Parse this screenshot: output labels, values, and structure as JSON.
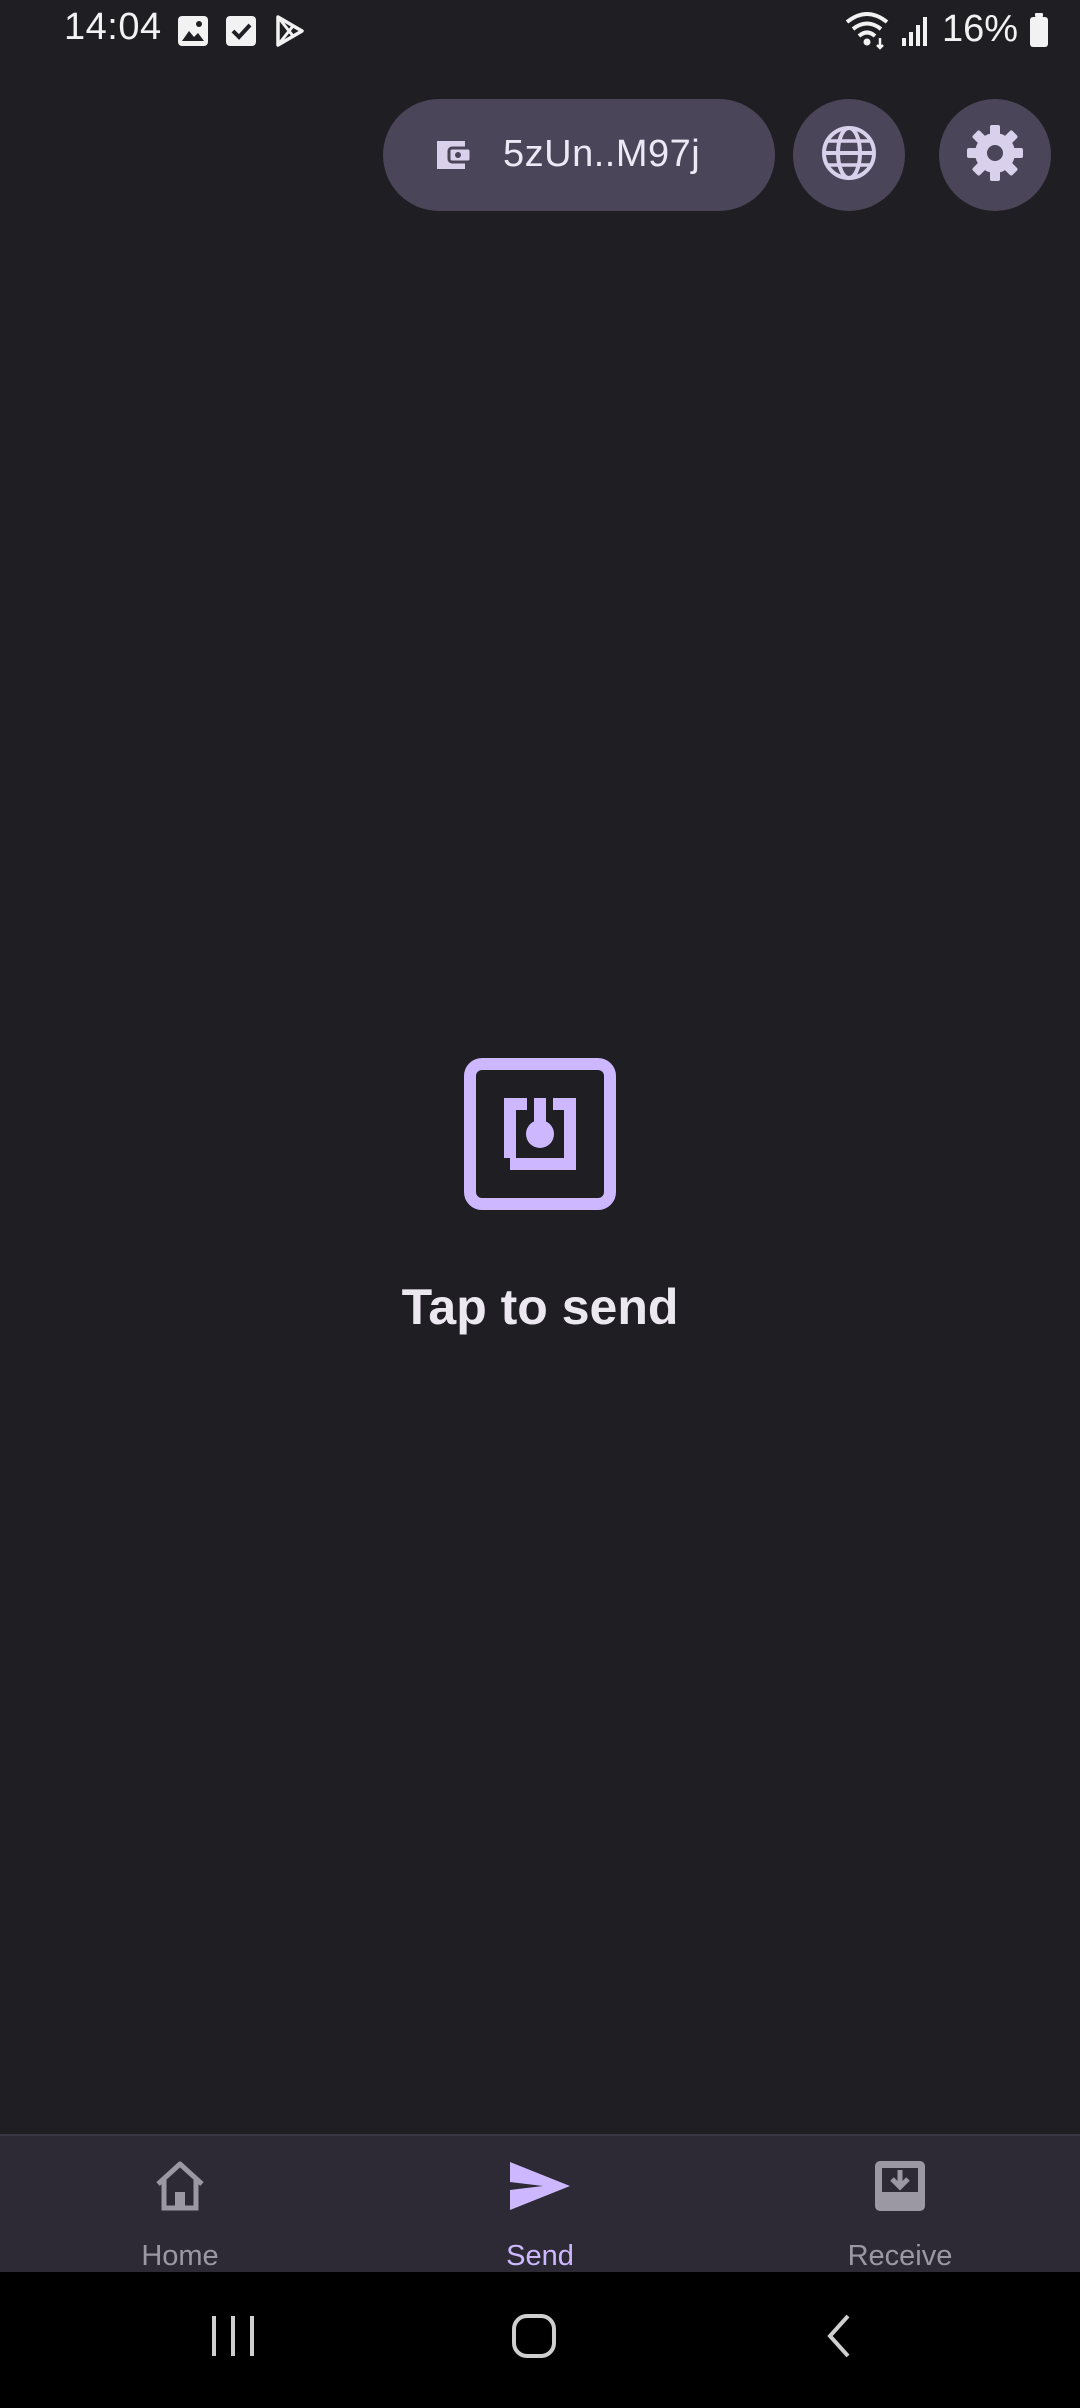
{
  "status_bar": {
    "time": "14:04",
    "left_icons": [
      "image-icon",
      "checkbox-icon",
      "play-store-icon"
    ],
    "right_icons": [
      "wifi-icon",
      "signal-icon"
    ],
    "battery_percent": "16%"
  },
  "header": {
    "wallet_address": "5zUn..M97j",
    "wallet_icon": "wallet-icon",
    "network_button_icon": "globe-icon",
    "settings_button_icon": "gear-icon"
  },
  "main": {
    "icon": "nfc-icon",
    "prompt": "Tap to send"
  },
  "bottom_nav": {
    "items": [
      {
        "label": "Home",
        "icon": "home-icon",
        "active": false
      },
      {
        "label": "Send",
        "icon": "send-icon",
        "active": true
      },
      {
        "label": "Receive",
        "icon": "inbox-download-icon",
        "active": false
      }
    ]
  },
  "system_nav": [
    "recents-icon",
    "home-circle-icon",
    "back-icon"
  ],
  "colors": {
    "background": "#1f1e23",
    "accent": "#cdb8ff",
    "chip": "#4a4558",
    "nav_bg": "#2d2a35"
  }
}
